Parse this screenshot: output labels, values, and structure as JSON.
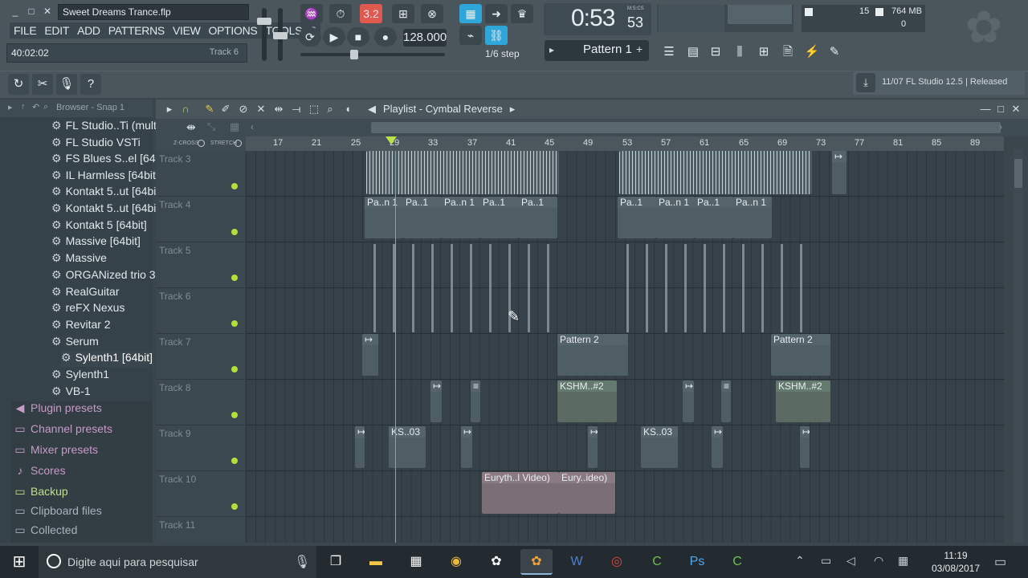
{
  "window": {
    "title": "Sweet Dreams Trance.flp"
  },
  "menu": [
    "FILE",
    "EDIT",
    "ADD",
    "PATTERNS",
    "VIEW",
    "OPTIONS",
    "TOOLS",
    "?"
  ],
  "hint": {
    "time": "40:02:02",
    "track": "Track 6"
  },
  "transport": {
    "bpm": "128.000",
    "step": "1/6 step",
    "time": "0:53",
    "time_small": "53",
    "time_unit": "M:S:CS",
    "pattern": "Pattern 1",
    "rec_indicator": "3.2"
  },
  "cpu": {
    "value": "15",
    "memory": "764 MB",
    "polyphony": "0"
  },
  "news": {
    "text": "11/07  FL Studio 12.5 | Released"
  },
  "browser": {
    "header": "Browser - Snap 1",
    "items": [
      "FL Studio..Ti (multi)",
      "FL Studio VSTi",
      "FS Blues S..el [64bit]",
      "IL Harmless [64bit]",
      "Kontakt 5..ut [64bit]",
      "Kontakt 5..ut [64bit]",
      "Kontakt 5 [64bit]",
      "Massive [64bit]",
      "Massive",
      "ORGANized trio 3.1",
      "RealGuitar",
      "reFX Nexus",
      "Revitar 2",
      "Serum",
      "Sylenth1 [64bit]",
      "Sylenth1",
      "VB-1"
    ],
    "categories": [
      "Plugin presets",
      "Channel presets",
      "Mixer presets",
      "Scores",
      "Backup",
      "Clipboard files",
      "Collected"
    ]
  },
  "playlist": {
    "title": "Playlist - Cymbal Reverse",
    "zcross": "Z-CROSS",
    "stretch": "STRETCH",
    "ruler": [
      "17",
      "21",
      "25",
      "29",
      "33",
      "37",
      "41",
      "45",
      "49",
      "53",
      "57",
      "61",
      "65",
      "69",
      "73",
      "77",
      "81",
      "85",
      "89"
    ],
    "tracks": [
      "Track 3",
      "Track 4",
      "Track 5",
      "Track 6",
      "Track 7",
      "Track 8",
      "Track 9",
      "Track 10",
      "Track 11"
    ],
    "clips": {
      "t4": [
        "Pa..n 1",
        "Pa..1",
        "Pa..n 1",
        "Pa..1",
        "Pa..1",
        "Pa..1",
        "Pa..n 1",
        "Pa..1",
        "Pa..n 1"
      ],
      "t7": [
        "Pattern 2",
        "Pattern 2"
      ],
      "t8": [
        "KSHM..#2",
        "KSHM..#2"
      ],
      "t9": [
        "KS..03",
        "KS..03"
      ],
      "t10": [
        "Euryth..l Video)",
        "Eury..ideo)"
      ]
    }
  },
  "taskbar": {
    "search_placeholder": "Digite aqui para pesquisar",
    "time": "11:19",
    "date": "03/08/2017"
  }
}
